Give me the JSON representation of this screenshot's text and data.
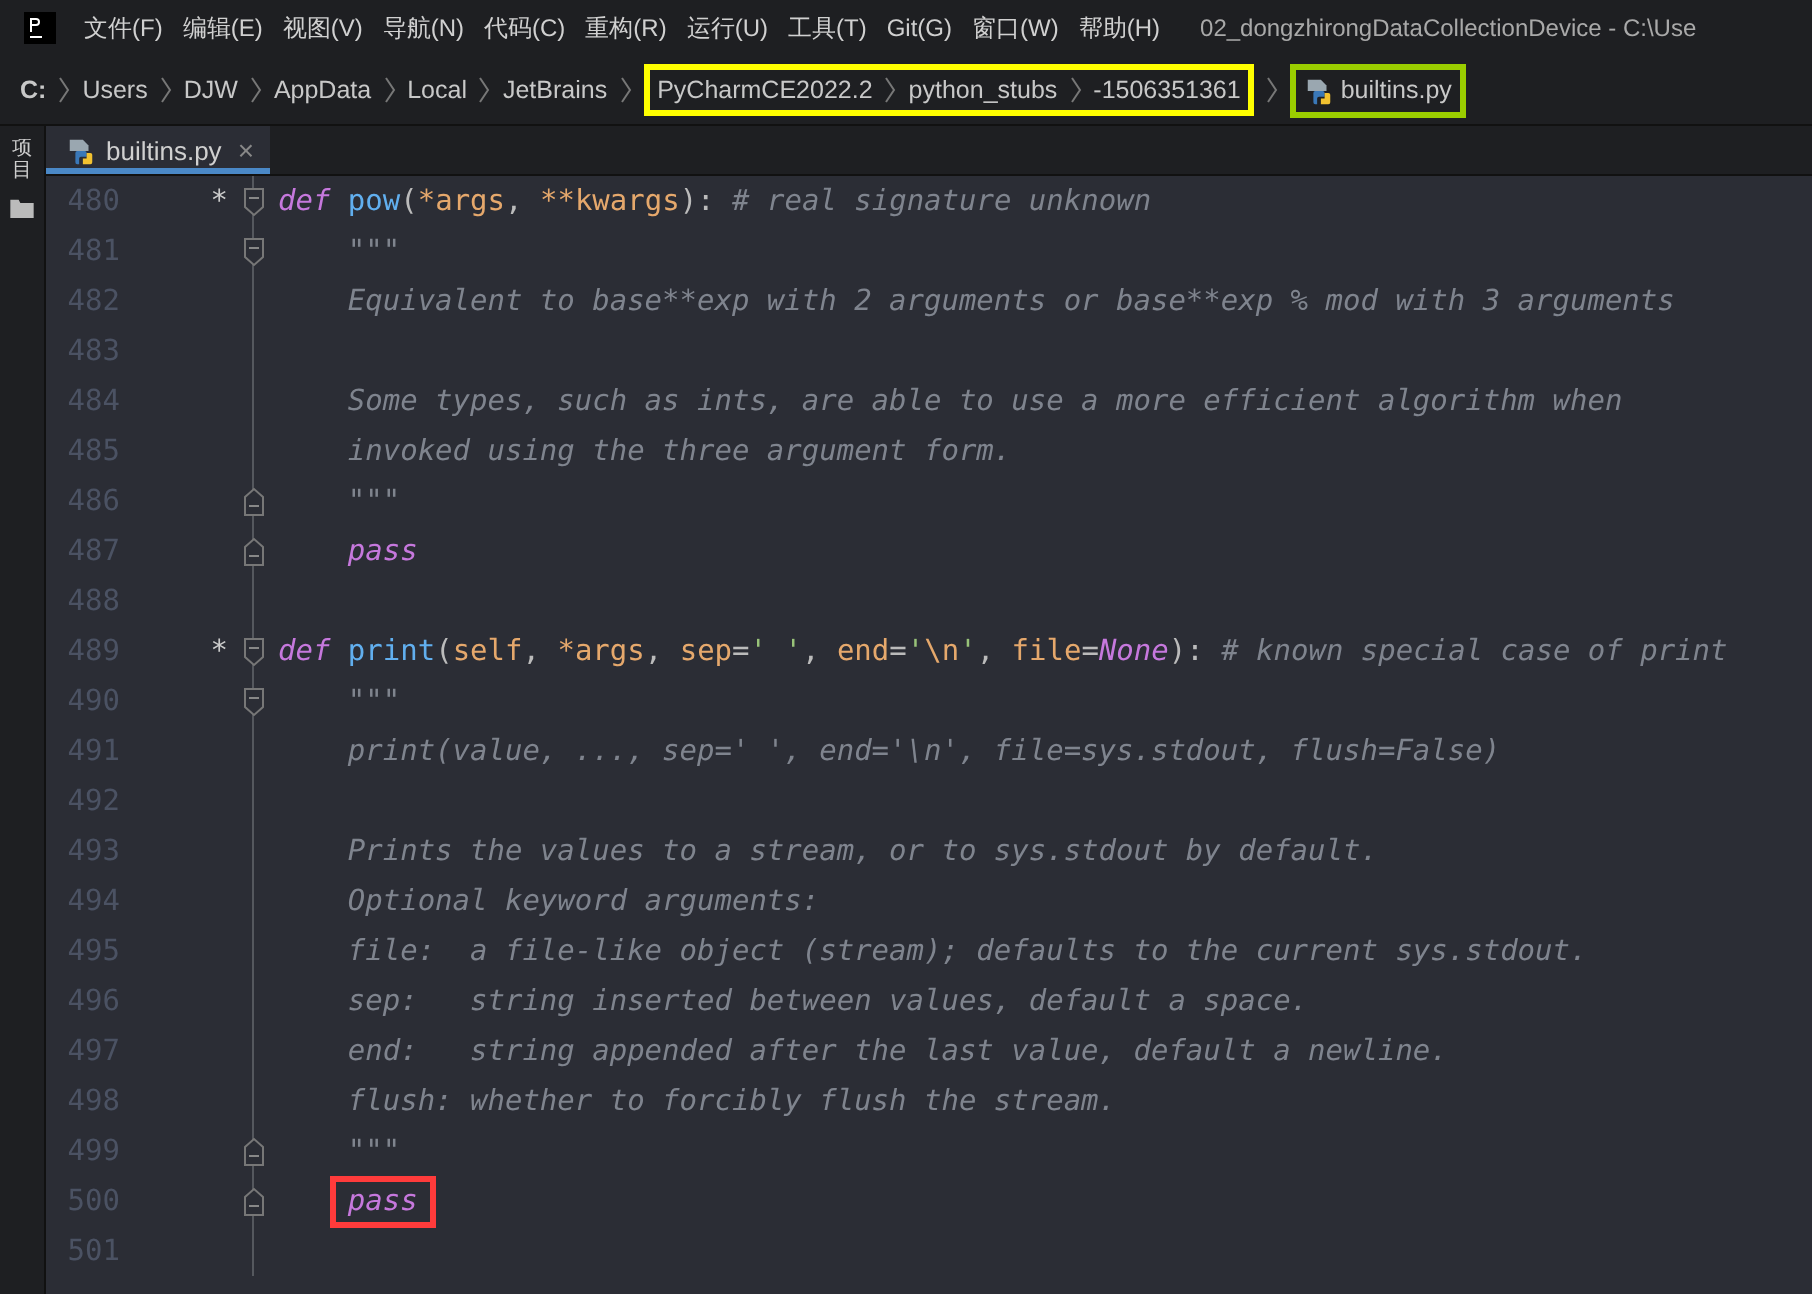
{
  "menu_bar": {
    "items": [
      "文件(F)",
      "编辑(E)",
      "视图(V)",
      "导航(N)",
      "代码(C)",
      "重构(R)",
      "运行(U)",
      "工具(T)",
      "Git(G)",
      "窗口(W)",
      "帮助(H)"
    ],
    "title": "02_dongzhirongDataCollectionDevice - C:\\Use"
  },
  "breadcrumb": [
    {
      "items": [
        "C:",
        "Users",
        "DJW",
        "AppData",
        "Local",
        "JetBrains"
      ]
    },
    {
      "color": "#ffff00",
      "items": [
        "PyCharmCE2022.2",
        "python_stubs",
        "-1506351361"
      ]
    },
    {
      "color": "#9acd00",
      "items": [
        "builtins.py"
      ],
      "file": true
    }
  ],
  "tool_strip": {
    "label": "项目"
  },
  "tabs": [
    {
      "label": "builtins.py",
      "selected": true,
      "close": "×"
    }
  ],
  "lines": [
    {
      "number": "480",
      "marker": "*",
      "kind": "opener",
      "tokens": [
        {
          "kind": "keyword",
          "text": "def"
        },
        {
          "kind": "name",
          "text": " pow"
        },
        {
          "kind": "plain",
          "text": "("
        },
        {
          "kind": "param",
          "text": "*args"
        },
        {
          "kind": "plain",
          "text": ", "
        },
        {
          "kind": "param",
          "text": "**kwargs"
        },
        {
          "kind": "plain",
          "text": "): "
        },
        {
          "kind": "comment",
          "text": "# real signature unknown"
        }
      ]
    },
    {
      "number": "481",
      "kind": "opener",
      "indented": true,
      "tokens": [
        {
          "kind": "doc",
          "text": "\"\"\""
        }
      ]
    },
    {
      "number": "482",
      "kind": "plain",
      "indented": true,
      "tokens": [
        {
          "kind": "doc",
          "text": "Equivalent to base**exp with 2 arguments or base**exp % mod with 3 arguments"
        }
      ]
    },
    {
      "number": "483",
      "kind": "plain"
    },
    {
      "number": "484",
      "kind": "plain",
      "indented": true,
      "tokens": [
        {
          "kind": "doc",
          "text": "Some types, such as ints, are able to use a more efficient algorithm when"
        }
      ]
    },
    {
      "number": "485",
      "kind": "plain",
      "indented": true,
      "tokens": [
        {
          "kind": "doc",
          "text": "invoked using the three argument form."
        }
      ]
    },
    {
      "number": "486",
      "kind": "closer",
      "indented": true,
      "tokens": [
        {
          "kind": "doc",
          "text": "\"\"\""
        }
      ]
    },
    {
      "number": "487",
      "kind": "closer",
      "indented": true,
      "tokens": [
        {
          "kind": "keyword",
          "text": "pass"
        }
      ]
    },
    {
      "number": "488",
      "kind": "plain"
    },
    {
      "number": "489",
      "marker": "*",
      "kind": "opener",
      "tokens": [
        {
          "kind": "keyword",
          "text": "def"
        },
        {
          "kind": "name",
          "text": " print"
        },
        {
          "kind": "plain",
          "text": "("
        },
        {
          "kind": "param",
          "text": "self"
        },
        {
          "kind": "plain",
          "text": ", "
        },
        {
          "kind": "param",
          "text": "*args"
        },
        {
          "kind": "plain",
          "text": ", "
        },
        {
          "kind": "param",
          "text": "sep"
        },
        {
          "kind": "plain",
          "text": "="
        },
        {
          "kind": "string",
          "text": "' '"
        },
        {
          "kind": "plain",
          "text": ", "
        },
        {
          "kind": "param",
          "text": "end"
        },
        {
          "kind": "plain",
          "text": "="
        },
        {
          "kind": "string",
          "text": "'"
        },
        {
          "kind": "escape",
          "text": "\\n"
        },
        {
          "kind": "string",
          "text": "'"
        },
        {
          "kind": "plain",
          "text": ", "
        },
        {
          "kind": "param",
          "text": "file"
        },
        {
          "kind": "plain",
          "text": "="
        },
        {
          "kind": "keyword",
          "text": "None"
        },
        {
          "kind": "plain",
          "text": "): "
        },
        {
          "kind": "comment",
          "text": "# known special case of print"
        }
      ]
    },
    {
      "number": "490",
      "kind": "opener",
      "indented": true,
      "tokens": [
        {
          "kind": "doc",
          "text": "\"\"\""
        }
      ]
    },
    {
      "number": "491",
      "kind": "plain",
      "indented": true,
      "tokens": [
        {
          "kind": "doc",
          "text": "print(value, ..., sep=' ', end='\\n', file=sys.stdout, flush=False)"
        }
      ]
    },
    {
      "number": "492",
      "kind": "plain"
    },
    {
      "number": "493",
      "kind": "plain",
      "indented": true,
      "tokens": [
        {
          "kind": "doc",
          "text": "Prints the values to a stream, or to sys.stdout by default."
        }
      ]
    },
    {
      "number": "494",
      "kind": "plain",
      "indented": true,
      "tokens": [
        {
          "kind": "doc",
          "text": "Optional keyword arguments:"
        }
      ]
    },
    {
      "number": "495",
      "kind": "plain",
      "indented": true,
      "tokens": [
        {
          "kind": "doc",
          "text": "file:  a file-like object (stream); defaults to the current sys.stdout."
        }
      ]
    },
    {
      "number": "496",
      "kind": "plain",
      "indented": true,
      "tokens": [
        {
          "kind": "doc",
          "text": "sep:   string inserted between values, default a space."
        }
      ]
    },
    {
      "number": "497",
      "kind": "plain",
      "indented": true,
      "tokens": [
        {
          "kind": "doc",
          "text": "end:   string appended after the last value, default a newline."
        }
      ]
    },
    {
      "number": "498",
      "kind": "plain",
      "indented": true,
      "tokens": [
        {
          "kind": "doc",
          "text": "flush: whether to forcibly flush the stream."
        }
      ]
    },
    {
      "number": "499",
      "kind": "closer",
      "indented": true,
      "tokens": [
        {
          "kind": "doc",
          "text": "\"\"\""
        }
      ]
    },
    {
      "number": "500",
      "kind": "closer",
      "indented": true,
      "tokens": [
        {
          "kind": "keyword",
          "text": "pass",
          "color": "#ff3b3b"
        }
      ]
    },
    {
      "number": "501",
      "kind": "plain"
    }
  ]
}
